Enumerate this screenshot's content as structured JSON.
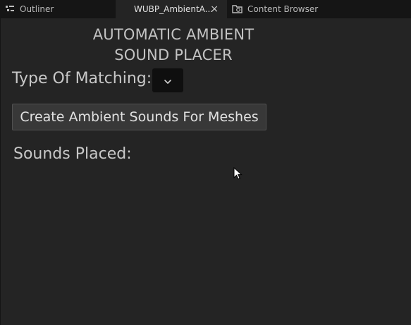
{
  "tabs": {
    "outliner": {
      "label": "Outliner",
      "icon": "outliner-icon"
    },
    "widget": {
      "label": "WUBP_AmbientA...",
      "icon": "widget-blueprint-icon",
      "close": "×"
    },
    "content_browser": {
      "label": "Content Browser",
      "icon": "content-browser-icon"
    }
  },
  "panel": {
    "title_line1": "AUTOMATIC AMBIENT",
    "title_line2": "SOUND PLACER",
    "matching_label": "Type Of Matching:",
    "matching_value": "",
    "create_button": "Create Ambient Sounds For Meshes",
    "sounds_placed_label": "Sounds Placed:"
  },
  "colors": {
    "panel_bg": "#242424",
    "tabbar_bg": "#151515",
    "button_bg": "#383838",
    "dropdown_bg": "#0f0f0f"
  }
}
